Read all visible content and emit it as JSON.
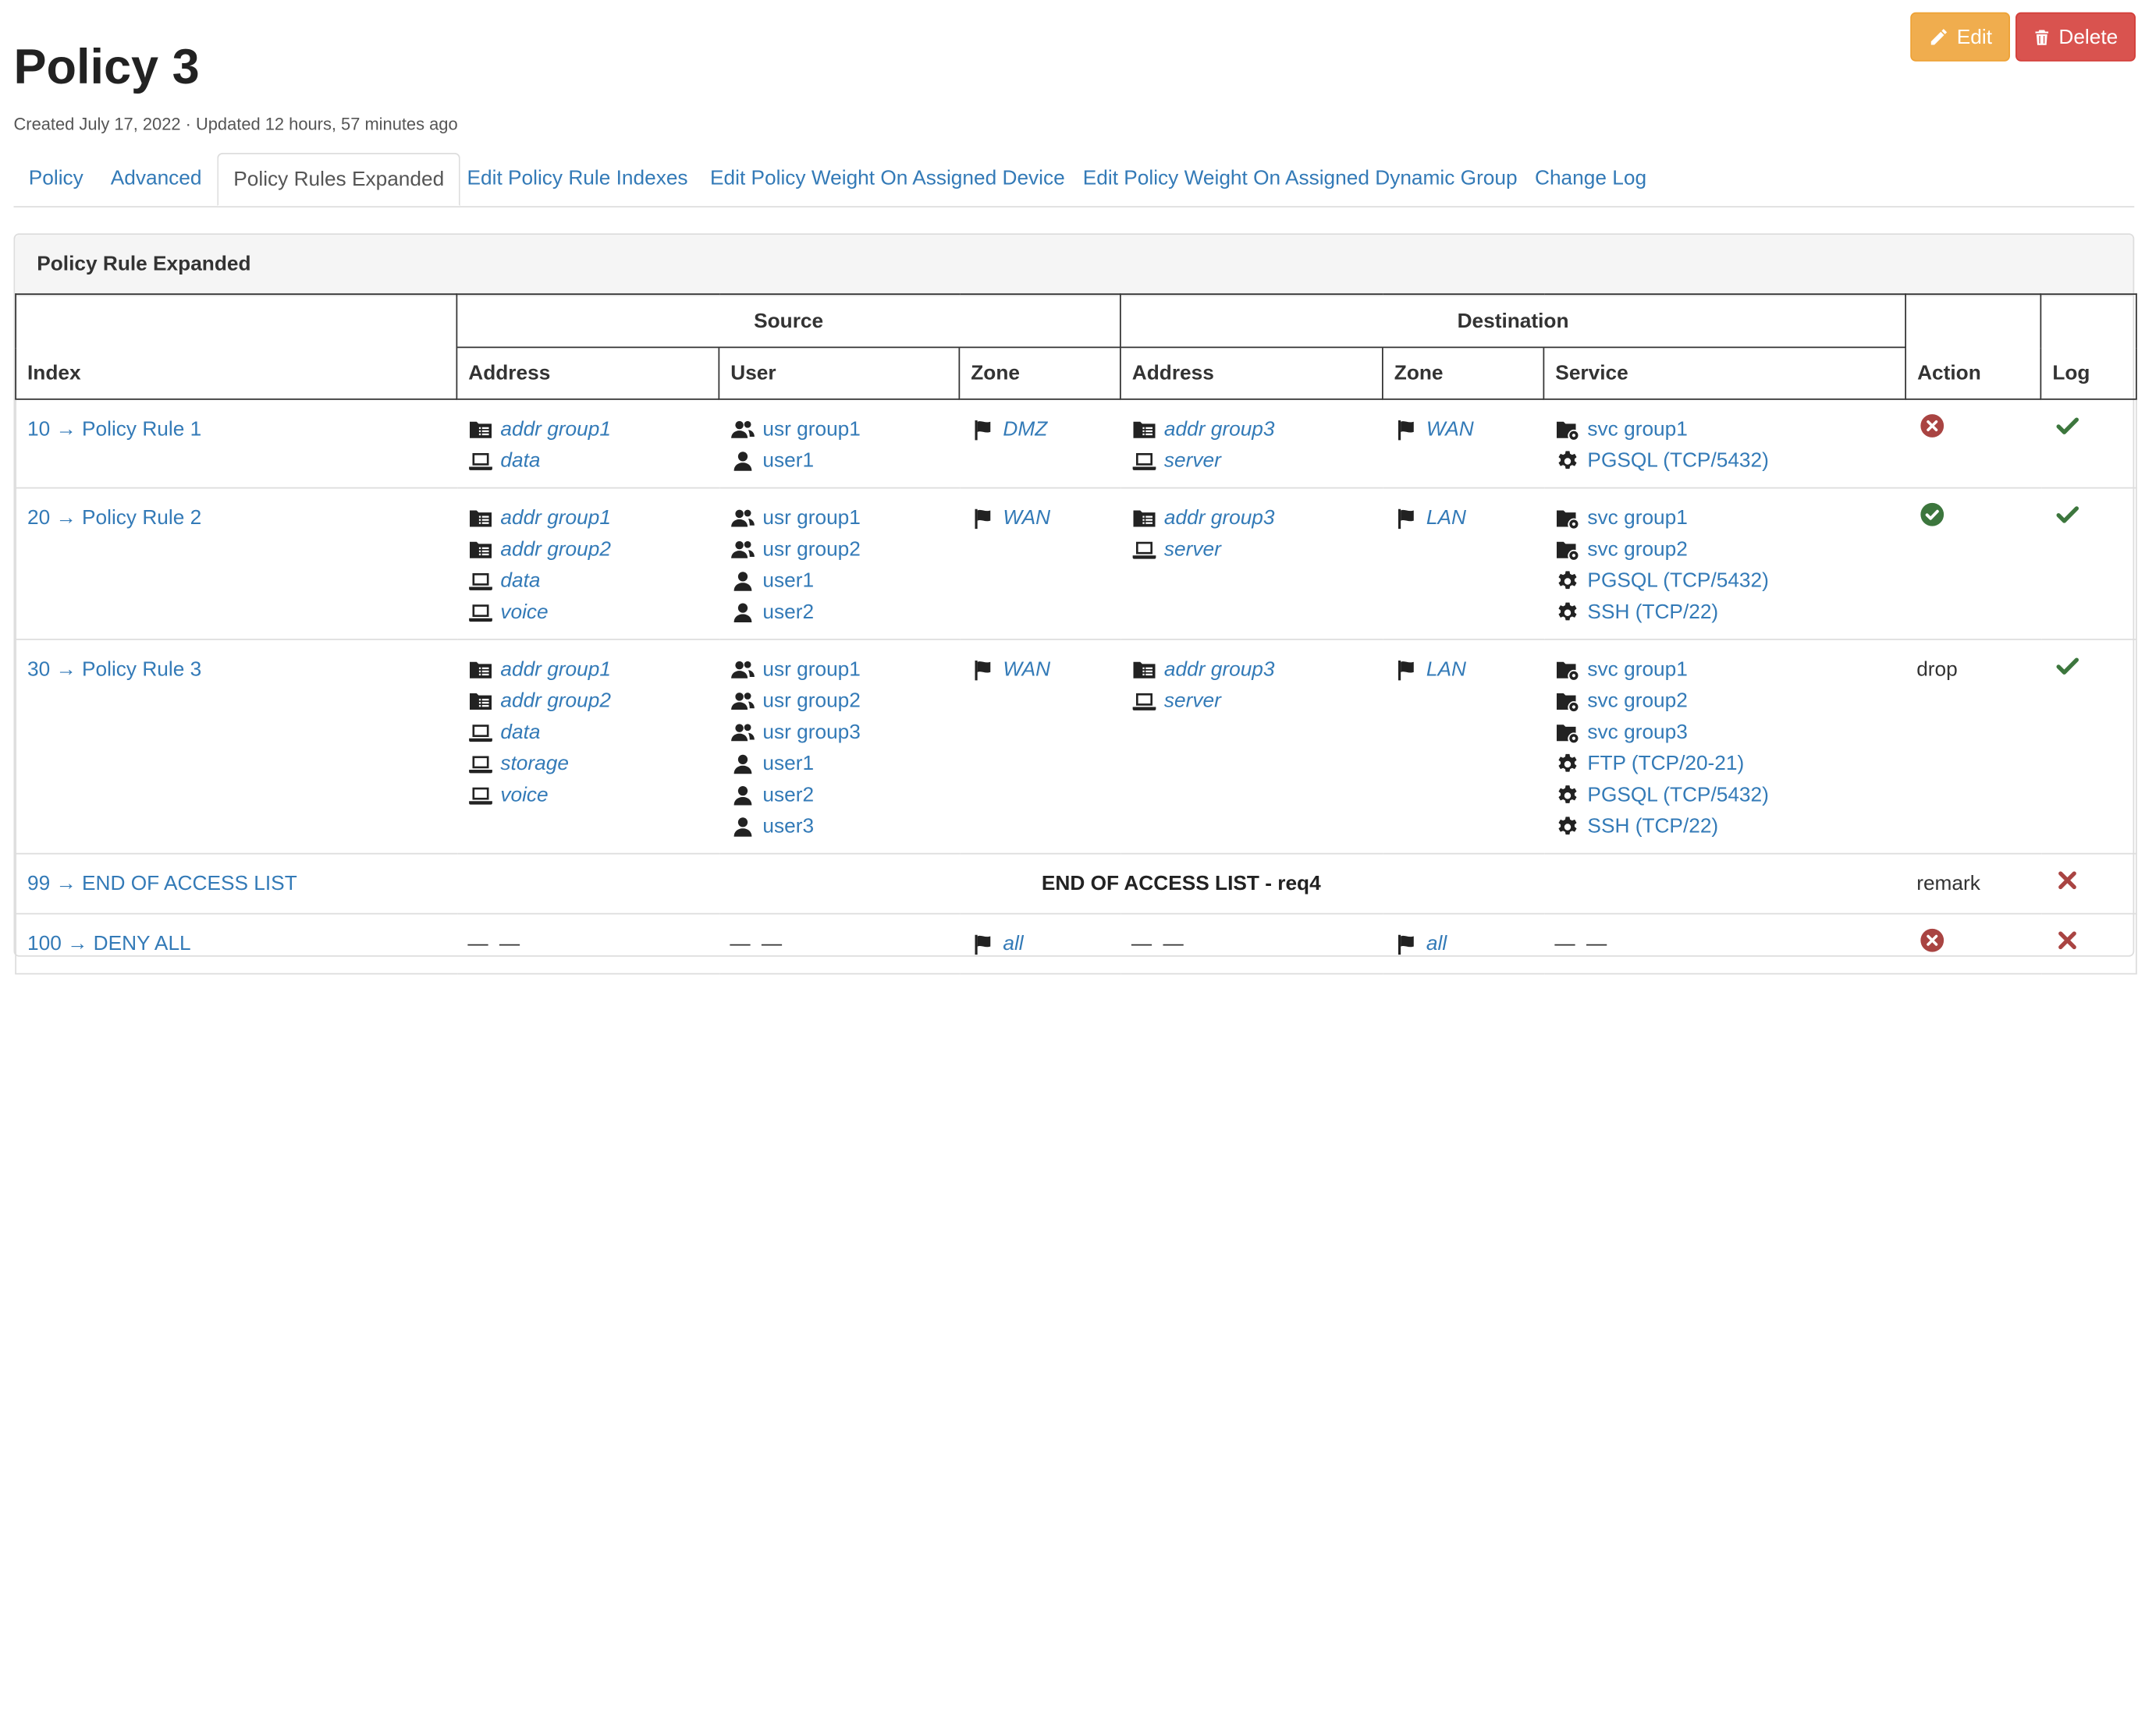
{
  "header": {
    "title": "Policy 3",
    "meta": "Created July 17, 2022 · Updated 12 hours, 57 minutes ago",
    "edit_label": "Edit",
    "delete_label": "Delete"
  },
  "tabs": [
    {
      "label": "Policy"
    },
    {
      "label": "Advanced"
    },
    {
      "label": "Policy Rules Expanded"
    },
    {
      "label": "Edit Policy Rule Indexes"
    },
    {
      "label": "Edit Policy Weight On Assigned Device"
    },
    {
      "label": "Edit Policy Weight On Assigned Dynamic Group"
    },
    {
      "label": "Change Log"
    }
  ],
  "active_tab": "Policy Rules Expanded",
  "panel": {
    "title": "Policy Rule Expanded",
    "headers": {
      "index": "Index",
      "source": "Source",
      "destination": "Destination",
      "address": "Address",
      "user": "User",
      "zone": "Zone",
      "service": "Service",
      "action": "Action",
      "log": "Log"
    }
  },
  "colors": {
    "link": "#337ab7",
    "success": "#3c763d",
    "danger": "#a94442",
    "edit": "#f0ad4e",
    "delete": "#d9534f"
  },
  "rows": [
    {
      "index": "10 → Policy Rule 1",
      "src_addr": [
        {
          "icon": "address-group-icon",
          "label": "addr group1"
        },
        {
          "icon": "laptop-icon",
          "label": "data"
        }
      ],
      "src_user": [
        {
          "icon": "users-icon",
          "label": "usr group1"
        },
        {
          "icon": "user-icon",
          "label": "user1"
        }
      ],
      "src_zone": [
        {
          "icon": "flag-icon",
          "label": "DMZ"
        }
      ],
      "dst_addr": [
        {
          "icon": "address-group-icon",
          "label": "addr group3"
        },
        {
          "icon": "laptop-icon",
          "label": "server"
        }
      ],
      "dst_zone": [
        {
          "icon": "flag-icon",
          "label": "WAN"
        }
      ],
      "service": [
        {
          "icon": "service-group-icon",
          "label": "svc group1"
        },
        {
          "icon": "gear-icon",
          "label": "PGSQL (TCP/5432)"
        }
      ],
      "action": {
        "icon": "deny-circle-icon"
      },
      "log": {
        "icon": "check-icon"
      }
    },
    {
      "index": "20 → Policy Rule 2",
      "src_addr": [
        {
          "icon": "address-group-icon",
          "label": "addr group1"
        },
        {
          "icon": "address-group-icon",
          "label": "addr group2"
        },
        {
          "icon": "laptop-icon",
          "label": "data"
        },
        {
          "icon": "laptop-icon",
          "label": "voice"
        }
      ],
      "src_user": [
        {
          "icon": "users-icon",
          "label": "usr group1"
        },
        {
          "icon": "users-icon",
          "label": "usr group2"
        },
        {
          "icon": "user-icon",
          "label": "user1"
        },
        {
          "icon": "user-icon",
          "label": "user2"
        }
      ],
      "src_zone": [
        {
          "icon": "flag-icon",
          "label": "WAN"
        }
      ],
      "dst_addr": [
        {
          "icon": "address-group-icon",
          "label": "addr group3"
        },
        {
          "icon": "laptop-icon",
          "label": "server"
        }
      ],
      "dst_zone": [
        {
          "icon": "flag-icon",
          "label": "LAN"
        }
      ],
      "service": [
        {
          "icon": "service-group-icon",
          "label": "svc group1"
        },
        {
          "icon": "service-group-icon",
          "label": "svc group2"
        },
        {
          "icon": "gear-icon",
          "label": "PGSQL (TCP/5432)"
        },
        {
          "icon": "gear-icon",
          "label": "SSH (TCP/22)"
        }
      ],
      "action": {
        "icon": "allow-circle-icon"
      },
      "log": {
        "icon": "check-icon"
      }
    },
    {
      "index": "30 → Policy Rule 3",
      "src_addr": [
        {
          "icon": "address-group-icon",
          "label": "addr group1"
        },
        {
          "icon": "address-group-icon",
          "label": "addr group2"
        },
        {
          "icon": "laptop-icon",
          "label": "data"
        },
        {
          "icon": "laptop-icon",
          "label": "storage"
        },
        {
          "icon": "laptop-icon",
          "label": "voice"
        }
      ],
      "src_user": [
        {
          "icon": "users-icon",
          "label": "usr group1"
        },
        {
          "icon": "users-icon",
          "label": "usr group2"
        },
        {
          "icon": "users-icon",
          "label": "usr group3"
        },
        {
          "icon": "user-icon",
          "label": "user1"
        },
        {
          "icon": "user-icon",
          "label": "user2"
        },
        {
          "icon": "user-icon",
          "label": "user3"
        }
      ],
      "src_zone": [
        {
          "icon": "flag-icon",
          "label": "WAN"
        }
      ],
      "dst_addr": [
        {
          "icon": "address-group-icon",
          "label": "addr group3"
        },
        {
          "icon": "laptop-icon",
          "label": "server"
        }
      ],
      "dst_zone": [
        {
          "icon": "flag-icon",
          "label": "LAN"
        }
      ],
      "service": [
        {
          "icon": "service-group-icon",
          "label": "svc group1"
        },
        {
          "icon": "service-group-icon",
          "label": "svc group2"
        },
        {
          "icon": "service-group-icon",
          "label": "svc group3"
        },
        {
          "icon": "gear-icon",
          "label": "FTP (TCP/20-21)"
        },
        {
          "icon": "gear-icon",
          "label": "PGSQL (TCP/5432)"
        },
        {
          "icon": "gear-icon",
          "label": "SSH (TCP/22)"
        }
      ],
      "action": {
        "text": "drop"
      },
      "log": {
        "icon": "check-icon"
      }
    },
    {
      "index": "99 → END OF ACCESS LIST",
      "remark": "END OF ACCESS LIST - req4",
      "action": {
        "text": "remark"
      },
      "log": {
        "icon": "x-icon"
      }
    },
    {
      "index": "100 → DENY ALL",
      "src_addr_text": "— —",
      "src_user_text": "— —",
      "src_zone": [
        {
          "icon": "flag-icon",
          "label": "all"
        }
      ],
      "dst_addr_text": "— —",
      "dst_zone": [
        {
          "icon": "flag-icon",
          "label": "all"
        }
      ],
      "service_text": "— —",
      "action": {
        "icon": "deny-circle-icon"
      },
      "log": {
        "icon": "x-icon"
      }
    }
  ]
}
